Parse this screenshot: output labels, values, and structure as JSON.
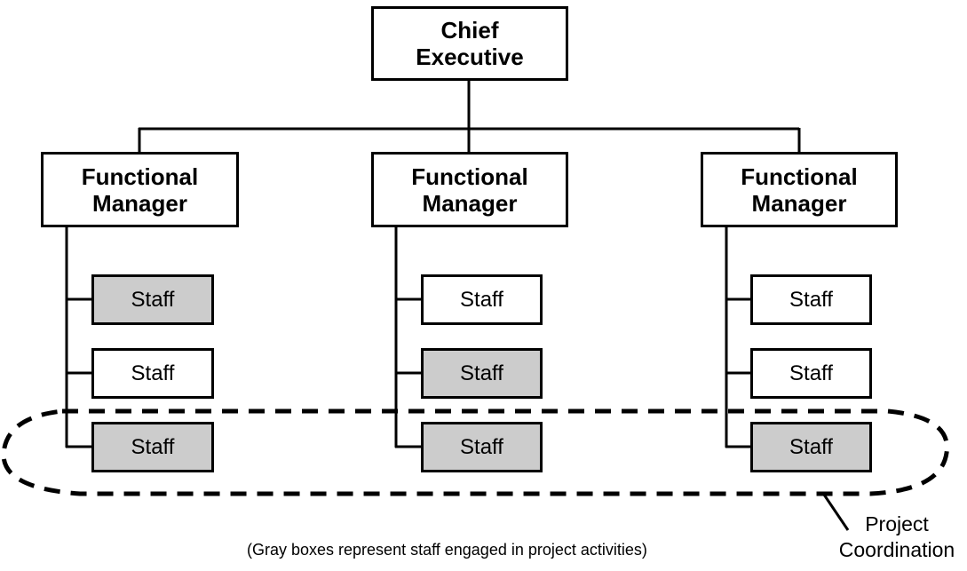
{
  "chief": {
    "label_line1": "Chief",
    "label_line2": "Executive"
  },
  "managers": [
    {
      "line1": "Functional",
      "line2": "Manager",
      "staff": [
        {
          "label": "Staff",
          "in_project": true
        },
        {
          "label": "Staff",
          "in_project": false
        },
        {
          "label": "Staff",
          "in_project": true
        }
      ]
    },
    {
      "line1": "Functional",
      "line2": "Manager",
      "staff": [
        {
          "label": "Staff",
          "in_project": false
        },
        {
          "label": "Staff",
          "in_project": true
        },
        {
          "label": "Staff",
          "in_project": true
        }
      ]
    },
    {
      "line1": "Functional",
      "line2": "Manager",
      "staff": [
        {
          "label": "Staff",
          "in_project": false
        },
        {
          "label": "Staff",
          "in_project": false
        },
        {
          "label": "Staff",
          "in_project": true
        }
      ]
    }
  ],
  "project_label": {
    "line1": "Project",
    "line2": "Coordination"
  },
  "footnote": "(Gray boxes represent staff engaged in project activities)",
  "colors": {
    "project_staff_fill": "#cccccc",
    "line": "#000000"
  }
}
